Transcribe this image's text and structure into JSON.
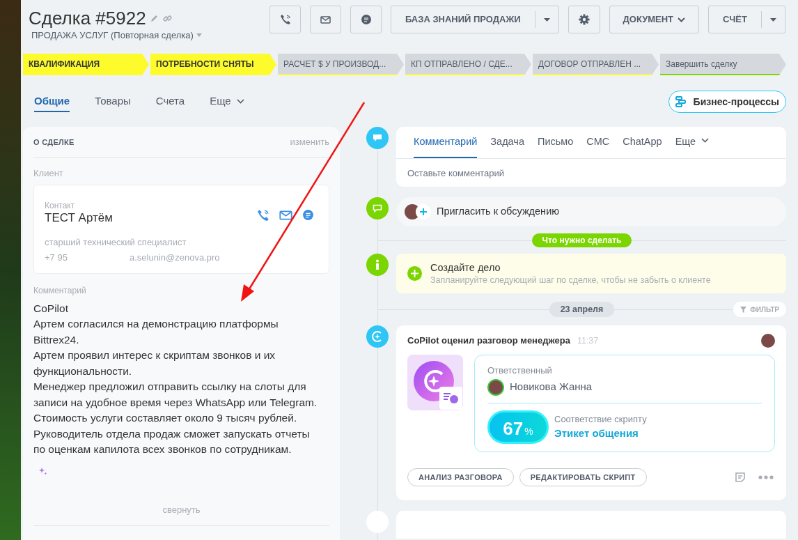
{
  "header": {
    "title": "Сделка #5922",
    "subtitle": "ПРОДАЖА УСЛУГ (Повторная сделка)",
    "knowledge_button": "БАЗА ЗНАНИЙ ПРОДАЖИ",
    "document_button": "ДОКУМЕНТ",
    "invoice_button": "СЧЁТ"
  },
  "stages": [
    {
      "label": "КВАЛИФИКАЦИЯ",
      "done": true,
      "color": "#fdfb2c"
    },
    {
      "label": "ПОТРЕБНОСТИ СНЯТЫ",
      "done": true,
      "color": "#fdfb2c"
    },
    {
      "label": "РАСЧЕТ $ У ПРОИЗВОД...",
      "done": false,
      "color": "#fdfb2c"
    },
    {
      "label": "КП ОТПРАВЛЕНО / СДЕ...",
      "done": false,
      "color": "#fdfb2c"
    },
    {
      "label": "ДОГОВОР ОТПРАВЛЕН ...",
      "done": false,
      "color": "#fdfb2c"
    },
    {
      "label": "Завершить сделку",
      "done": false,
      "color": "#7bd500"
    }
  ],
  "tabs": [
    {
      "label": "Общие",
      "selected": true,
      "kind": "plain"
    },
    {
      "label": "Товары",
      "selected": false,
      "kind": "plain"
    },
    {
      "label": "Счета",
      "selected": false,
      "kind": "plain"
    },
    {
      "label": "Еще",
      "selected": false,
      "kind": "dropdown"
    }
  ],
  "business_processes_button": "Бизнес-процессы",
  "deal_card": {
    "title": "О СДЕЛКЕ",
    "edit_link": "изменить",
    "client_label": "Клиент",
    "contact": {
      "label": "Контакт",
      "name": "ТЕСТ Артём",
      "position": "старший технический специалист",
      "phone": "+7 95",
      "email": "a.selunin@zenova.pro"
    },
    "comment_label": "Комментарий",
    "comment_paragraphs": [
      "CoPilot",
      "Артем согласился на демонстрацию платформы Bittrex24.",
      "Артем проявил интерес к скриптам звонков и их функциональности.",
      "Менеджер предложил отправить ссылку на слоты для записи на удобное время через WhatsApp или Telegram.",
      "Стоимость услуги составляет около 9 тысяч рублей.",
      "Руководитель отдела продаж сможет запускать отчеты по оценкам капилота всех звонков по сотрудникам."
    ],
    "collapse_link": "свернуть"
  },
  "timeline": {
    "composer_tabs": [
      {
        "label": "Комментарий",
        "selected": true,
        "kind": "plain"
      },
      {
        "label": "Задача",
        "selected": false,
        "kind": "plain"
      },
      {
        "label": "Письмо",
        "selected": false,
        "kind": "plain"
      },
      {
        "label": "СМС",
        "selected": false,
        "kind": "plain"
      },
      {
        "label": "ChatApp",
        "selected": false,
        "kind": "plain"
      },
      {
        "label": "Еще",
        "selected": false,
        "kind": "dropdown"
      }
    ],
    "composer_placeholder": "Оставьте комментарий",
    "invite": "Пригласить к обсуждению",
    "todo_badge": "Что нужно сделать",
    "create_task": {
      "title": "Создайте дело",
      "hint": "Запланируйте следующий шаг по сделке, чтобы не забыть о клиенте"
    },
    "date_badge": "23 апреля",
    "filter_button": "ФИЛЬТР",
    "copilot_card": {
      "title": "CoPilot оценил разговор менеджера",
      "time": "11:37",
      "responsible_label": "Ответственный",
      "responsible_name": "Новикова Жанна",
      "score": "67",
      "score_unit": "%",
      "match_label": "Соответствие скрипту",
      "script_name": "Этикет общения",
      "buttons": [
        "АНАЛИЗ РАЗГОВОРА",
        "РЕДАКТИРОВАТЬ СКРИПТ"
      ]
    }
  }
}
